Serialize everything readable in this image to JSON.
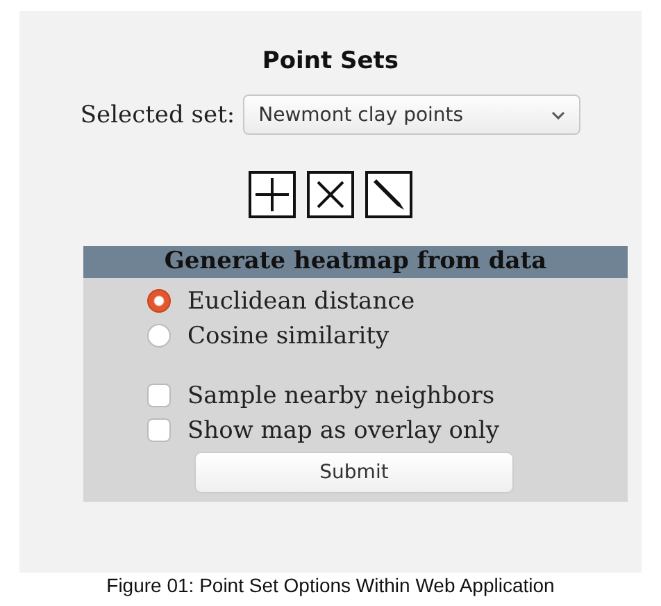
{
  "title": "Point Sets",
  "selected_set": {
    "label": "Selected set:",
    "value": "Newmont clay points"
  },
  "tools": [
    {
      "kind": "add"
    },
    {
      "kind": "delete"
    },
    {
      "kind": "edit"
    }
  ],
  "heatmap": {
    "title": "Generate heatmap from data",
    "methods": [
      {
        "label": "Euclidean distance",
        "selected": true
      },
      {
        "label": "Cosine similarity",
        "selected": false
      }
    ],
    "options": [
      {
        "label": "Sample nearby neighbors",
        "checked": false
      },
      {
        "label": "Show map as overlay only",
        "checked": false
      }
    ],
    "submit": "Submit"
  },
  "caption": "Figure 01: Point Set Options Within Web Application"
}
